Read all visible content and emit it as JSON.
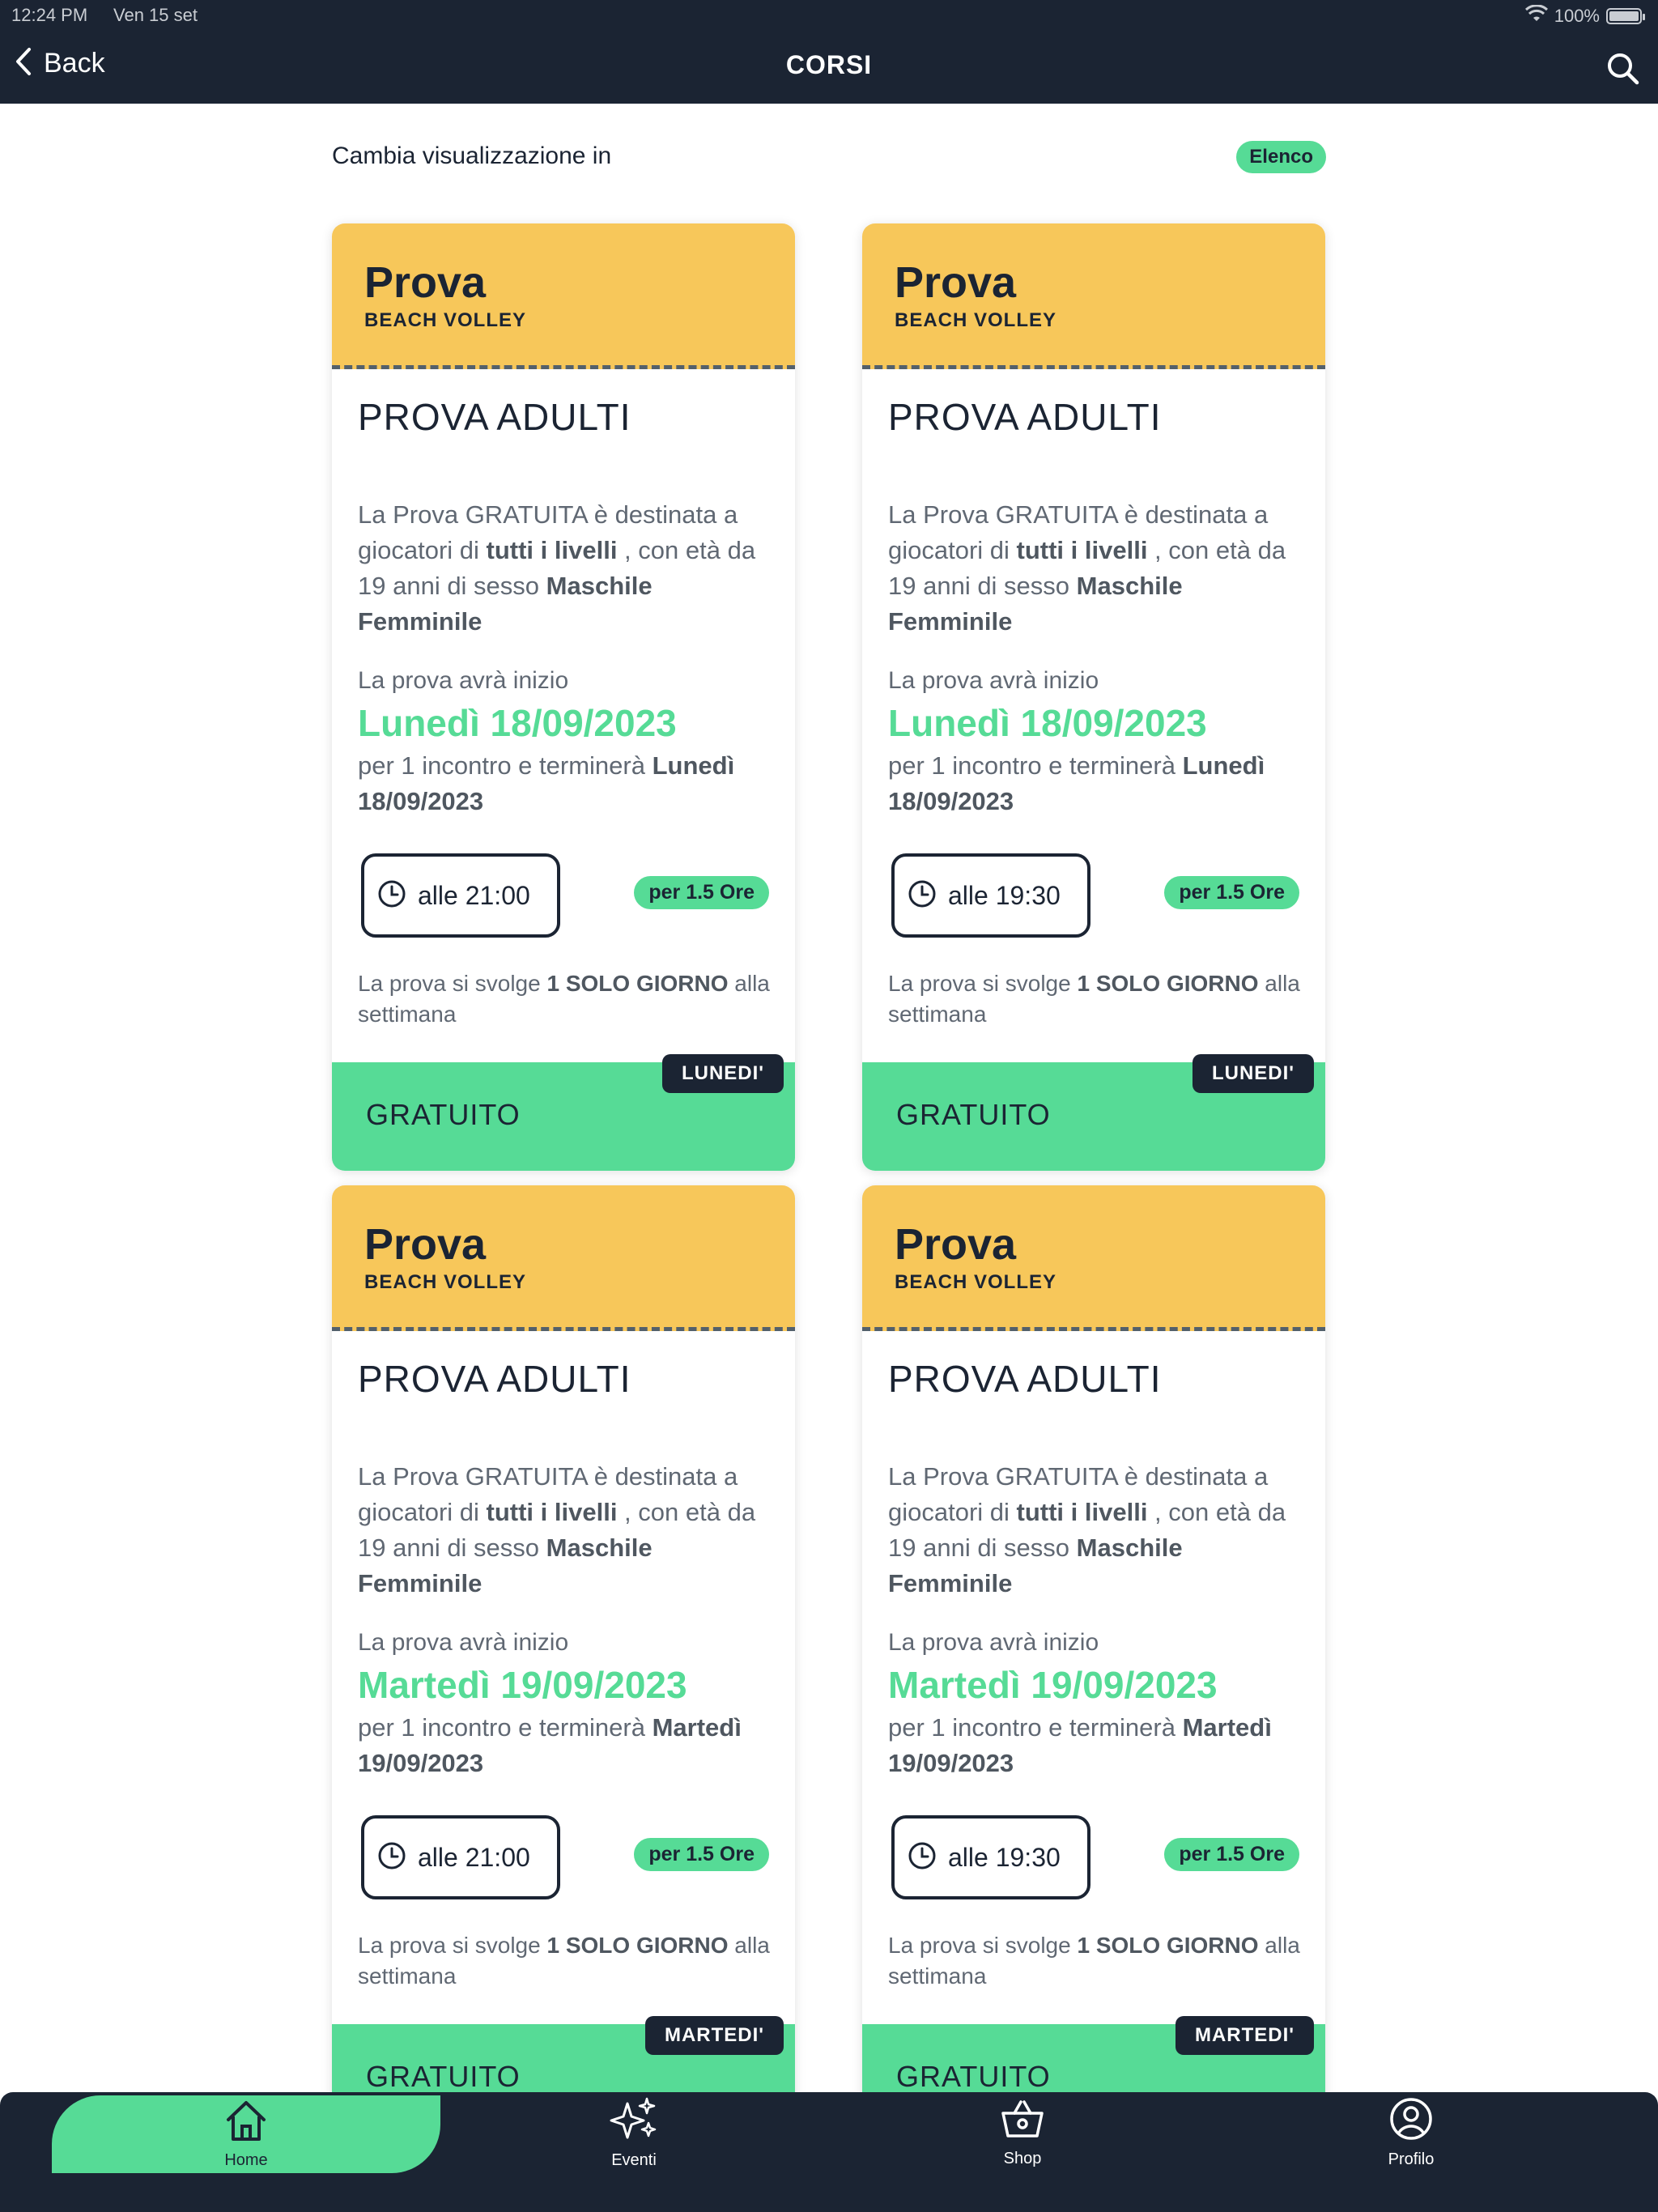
{
  "status": {
    "time": "12:24 PM",
    "date": "Ven 15 set",
    "battery": "100%",
    "battery_level": 1.0
  },
  "nav": {
    "back_label": "Back",
    "title": "CORSI"
  },
  "view_switch": {
    "label": "Cambia visualizzazione in",
    "option": "Elenco"
  },
  "cards": [
    {
      "category": "Prova",
      "sport": "BEACH VOLLEY",
      "name": "PROVA ADULTI",
      "desc_a": "La Prova GRATUITA è destinata a giocatori di ",
      "desc_levels": "tutti i livelli",
      "desc_b": " , con età da 19 anni di sesso ",
      "desc_gender": "Maschile Femminile",
      "start_label": "La prova avrà inizio",
      "start_date": "Lunedì 18/09/2023",
      "end_text": " per 1 incontro e terminerà ",
      "end_date": "Lunedì 18/09/2023",
      "time": "alle 21:00",
      "duration": "per 1.5 Ore",
      "freq_a": "La prova si svolge ",
      "freq_b": "1 SOLO GIORNO",
      "freq_c": " alla settimana",
      "price": "GRATUITO",
      "day": "LUNEDI'"
    },
    {
      "category": "Prova",
      "sport": "BEACH VOLLEY",
      "name": "PROVA ADULTI",
      "desc_a": "La Prova GRATUITA è destinata a giocatori di ",
      "desc_levels": "tutti i livelli",
      "desc_b": " , con età da 19 anni di sesso ",
      "desc_gender": "Maschile Femminile",
      "start_label": "La prova avrà inizio",
      "start_date": "Lunedì 18/09/2023",
      "end_text": " per 1 incontro e terminerà ",
      "end_date": "Lunedì 18/09/2023",
      "time": "alle 19:30",
      "duration": "per 1.5 Ore",
      "freq_a": "La prova si svolge ",
      "freq_b": "1 SOLO GIORNO",
      "freq_c": " alla settimana",
      "price": "GRATUITO",
      "day": "LUNEDI'"
    },
    {
      "category": "Prova",
      "sport": "BEACH VOLLEY",
      "name": "PROVA ADULTI",
      "desc_a": "La Prova GRATUITA è destinata a giocatori di ",
      "desc_levels": "tutti i livelli",
      "desc_b": " , con età da 19 anni di sesso ",
      "desc_gender": "Maschile Femminile",
      "start_label": "La prova avrà inizio",
      "start_date": "Martedì 19/09/2023",
      "end_text": " per 1 incontro e terminerà ",
      "end_date": "Martedì 19/09/2023",
      "time": "alle 21:00",
      "duration": "per 1.5 Ore",
      "freq_a": "La prova si svolge ",
      "freq_b": "1 SOLO GIORNO",
      "freq_c": " alla settimana",
      "price": "GRATUITO",
      "day": "MARTEDI'"
    },
    {
      "category": "Prova",
      "sport": "BEACH VOLLEY",
      "name": "PROVA ADULTI",
      "desc_a": "La Prova GRATUITA è destinata a giocatori di ",
      "desc_levels": "tutti i livelli",
      "desc_b": " , con età da 19 anni di sesso ",
      "desc_gender": "Maschile Femminile",
      "start_label": "La prova avrà inizio",
      "start_date": "Martedì 19/09/2023",
      "end_text": " per 1 incontro e terminerà ",
      "end_date": "Martedì 19/09/2023",
      "time": "alle 19:30",
      "duration": "per 1.5 Ore",
      "freq_a": "La prova si svolge ",
      "freq_b": "1 SOLO GIORNO",
      "freq_c": " alla settimana",
      "price": "GRATUITO",
      "day": "MARTEDI'"
    }
  ],
  "tabbar": {
    "items": [
      {
        "label": "Home",
        "icon": "home-icon",
        "active": true
      },
      {
        "label": "Eventi",
        "icon": "sparkles-icon",
        "active": false
      },
      {
        "label": "Shop",
        "icon": "basket-icon",
        "active": false
      },
      {
        "label": "Profilo",
        "icon": "profile-icon",
        "active": false
      }
    ]
  },
  "colors": {
    "navy": "#1b2433",
    "green": "#56db96",
    "yellow": "#f7c75a",
    "text_grey": "#606873"
  }
}
